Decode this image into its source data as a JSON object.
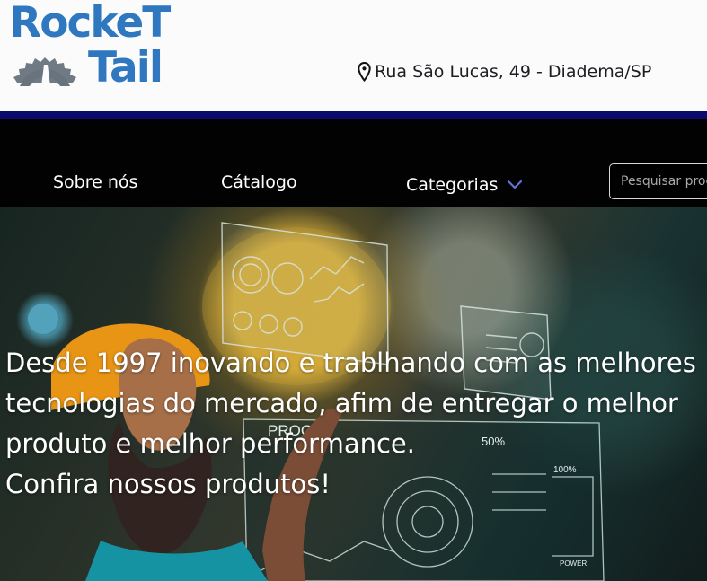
{
  "brand": {
    "name_line_1": "RockeT",
    "name_line_2": "Tail",
    "colors": {
      "logo_blue": "#2f78bf",
      "logo_gray": "#68737d",
      "stripe": "#0b0b6e",
      "nav_background": "#020202",
      "chevron": "#6870d4"
    }
  },
  "header": {
    "address": "Rua São Lucas, 49 - Diadema/SP",
    "address_icon": "map-pin-icon"
  },
  "nav": {
    "items": [
      {
        "label": "Sobre nós"
      },
      {
        "label": "Cátalogo"
      },
      {
        "label": "Categorias",
        "icon": "chevron-down-icon"
      }
    ],
    "search": {
      "placeholder": "Pesquisar produtos"
    }
  },
  "hero": {
    "lines": [
      "Desde 1997 inovando e trablhando com as melhores",
      "tecnologias do mercado, afim de entregar o melhor",
      "produto e melhor performance.",
      "Confira nossos produtos!"
    ],
    "visible_graphic_text": {
      "label_progress": "PROGR",
      "label_percent": "50%",
      "label_hundred": "100%",
      "label_power": "POWER"
    }
  }
}
